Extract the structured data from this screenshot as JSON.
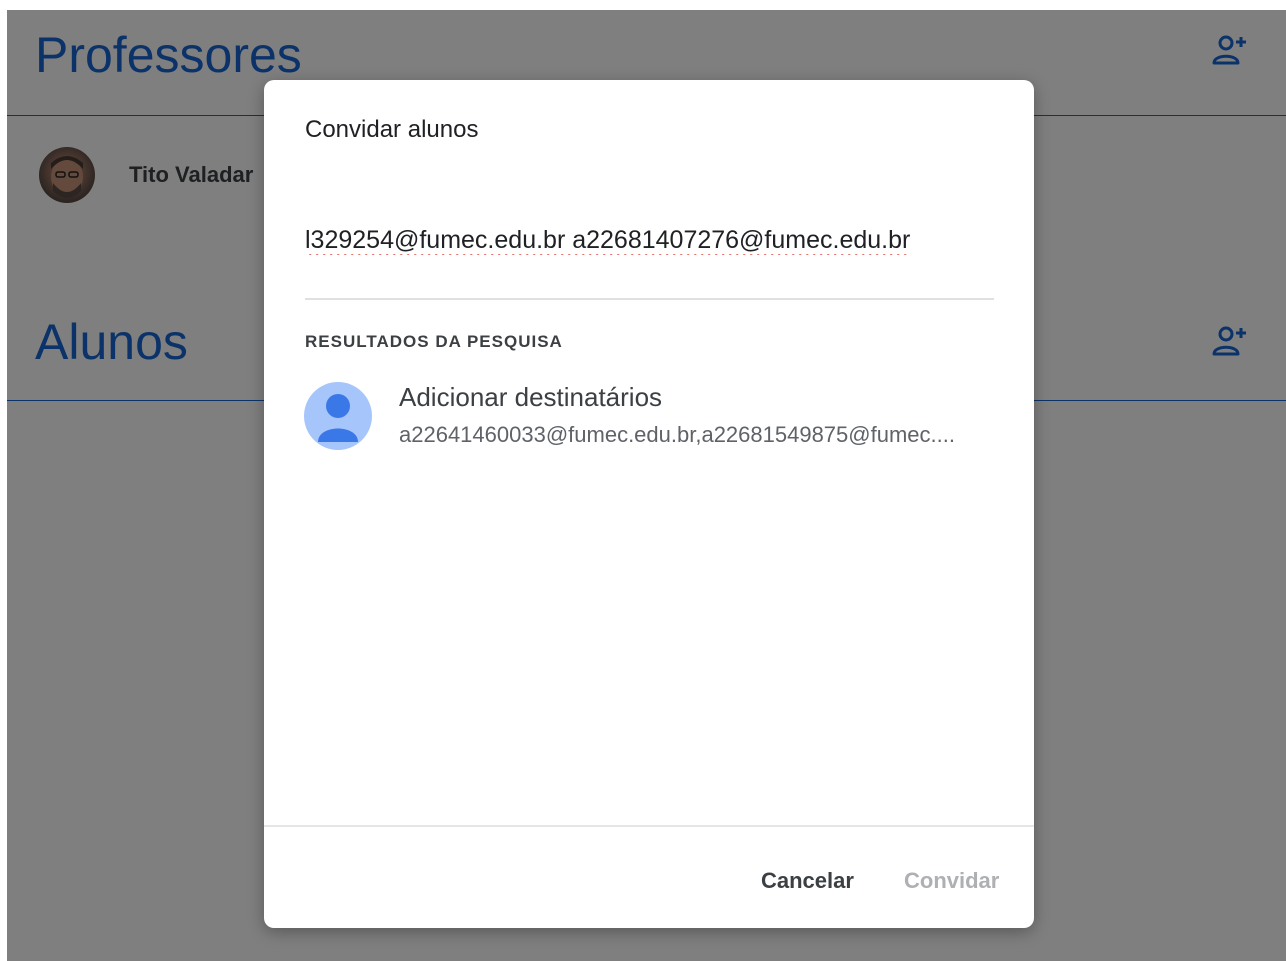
{
  "sections": {
    "teachers_title": "Professores",
    "students_title": "Alunos"
  },
  "teachers": [
    {
      "name": "Tito Valadar"
    }
  ],
  "icons": {
    "add_teacher": "person-add-icon",
    "add_student": "person-add-icon",
    "result_avatar": "person-icon"
  },
  "dialog": {
    "title": "Convidar alunos",
    "input_value": "l329254@fumec.edu.br a22681407276@fumec.edu.br",
    "results_label": "RESULTADOS DA PESQUISA",
    "result": {
      "title": "Adicionar destinatários",
      "subtitle": "a22641460033@fumec.edu.br,a22681549875@fumec...."
    },
    "cancel_label": "Cancelar",
    "invite_label": "Convidar"
  },
  "colors": {
    "accent": "#1967d2",
    "overlay": "rgba(0,0,0,0.5)",
    "avatar_bg": "#a6c5fb",
    "avatar_fg": "#3b78e7",
    "disabled_text": "#aeb0b3"
  }
}
